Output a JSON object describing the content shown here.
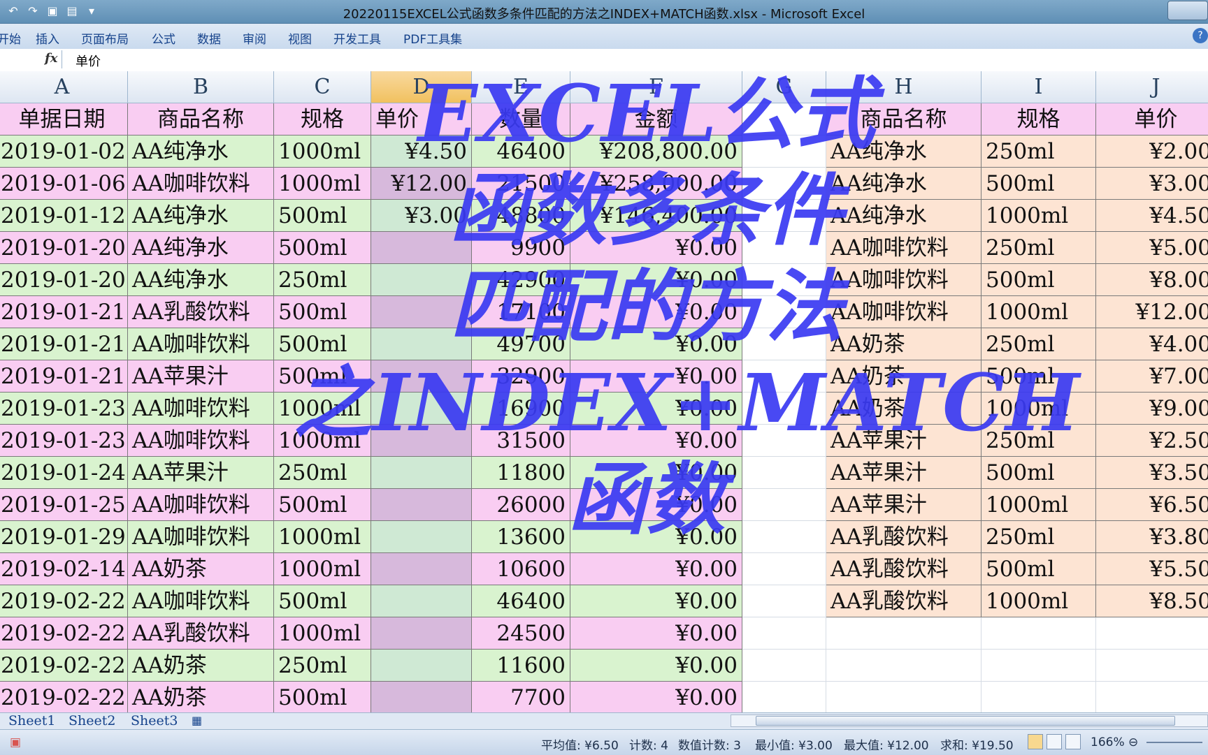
{
  "window": {
    "title": "20220115EXCEL公式函数多条件匹配的方法之INDEX+MATCH函数.xlsx - Microsoft Excel"
  },
  "ribbon": {
    "tabs": [
      "开始",
      "插入",
      "页面布局",
      "公式",
      "数据",
      "审阅",
      "视图",
      "开发工具",
      "PDF工具集"
    ]
  },
  "formula_bar": {
    "fx_label": "fx",
    "content": "单价"
  },
  "columns": [
    "A",
    "B",
    "C",
    "D",
    "E",
    "F",
    "G",
    "H",
    "I",
    "J"
  ],
  "selected_column": "D",
  "left_table": {
    "headers": [
      "单据日期",
      "商品名称",
      "规格",
      "单价",
      "数量",
      "金额"
    ],
    "rows": [
      [
        "2019-01-02",
        "AA纯净水",
        "1000ml",
        "¥4.50",
        "46400",
        "¥208,800.00"
      ],
      [
        "2019-01-06",
        "AA咖啡饮料",
        "1000ml",
        "¥12.00",
        "21500",
        "¥258,000.00"
      ],
      [
        "2019-01-12",
        "AA纯净水",
        "500ml",
        "¥3.00",
        "48800",
        "¥146,400.00"
      ],
      [
        "2019-01-20",
        "AA纯净水",
        "500ml",
        "",
        "9900",
        "¥0.00"
      ],
      [
        "2019-01-20",
        "AA纯净水",
        "250ml",
        "",
        "42900",
        "¥0.00"
      ],
      [
        "2019-01-21",
        "AA乳酸饮料",
        "500ml",
        "",
        "17100",
        "¥0.00"
      ],
      [
        "2019-01-21",
        "AA咖啡饮料",
        "500ml",
        "",
        "49700",
        "¥0.00"
      ],
      [
        "2019-01-21",
        "AA苹果汁",
        "500ml",
        "",
        "32900",
        "¥0.00"
      ],
      [
        "2019-01-23",
        "AA咖啡饮料",
        "1000ml",
        "",
        "16900",
        "¥0.00"
      ],
      [
        "2019-01-23",
        "AA咖啡饮料",
        "1000ml",
        "",
        "31500",
        "¥0.00"
      ],
      [
        "2019-01-24",
        "AA苹果汁",
        "250ml",
        "",
        "11800",
        "¥0.00"
      ],
      [
        "2019-01-25",
        "AA咖啡饮料",
        "500ml",
        "",
        "26000",
        "¥0.00"
      ],
      [
        "2019-01-29",
        "AA咖啡饮料",
        "1000ml",
        "",
        "13600",
        "¥0.00"
      ],
      [
        "2019-02-14",
        "AA奶茶",
        "1000ml",
        "",
        "10600",
        "¥0.00"
      ],
      [
        "2019-02-22",
        "AA咖啡饮料",
        "500ml",
        "",
        "46400",
        "¥0.00"
      ],
      [
        "2019-02-22",
        "AA乳酸饮料",
        "1000ml",
        "",
        "24500",
        "¥0.00"
      ],
      [
        "2019-02-22",
        "AA奶茶",
        "250ml",
        "",
        "11600",
        "¥0.00"
      ],
      [
        "2019-02-22",
        "AA奶茶",
        "500ml",
        "",
        "7700",
        "¥0.00"
      ]
    ]
  },
  "right_table": {
    "headers": [
      "商品名称",
      "规格",
      "单价"
    ],
    "rows": [
      [
        "AA纯净水",
        "250ml",
        "¥2.00"
      ],
      [
        "AA纯净水",
        "500ml",
        "¥3.00"
      ],
      [
        "AA纯净水",
        "1000ml",
        "¥4.50"
      ],
      [
        "AA咖啡饮料",
        "250ml",
        "¥5.00"
      ],
      [
        "AA咖啡饮料",
        "500ml",
        "¥8.00"
      ],
      [
        "AA咖啡饮料",
        "1000ml",
        "¥12.00"
      ],
      [
        "AA奶茶",
        "250ml",
        "¥4.00"
      ],
      [
        "AA奶茶",
        "500ml",
        "¥7.00"
      ],
      [
        "AA奶茶",
        "1000ml",
        "¥9.00"
      ],
      [
        "AA苹果汁",
        "250ml",
        "¥2.50"
      ],
      [
        "AA苹果汁",
        "500ml",
        "¥3.50"
      ],
      [
        "AA苹果汁",
        "1000ml",
        "¥6.50"
      ],
      [
        "AA乳酸饮料",
        "250ml",
        "¥3.80"
      ],
      [
        "AA乳酸饮料",
        "500ml",
        "¥5.50"
      ],
      [
        "AA乳酸饮料",
        "1000ml",
        "¥8.50"
      ]
    ]
  },
  "overlay": {
    "lines": [
      "EXCEL公式",
      "函数多条件",
      "匹配的方法",
      "之INDEX+MATCH",
      "函数"
    ],
    "color": "#3a3af2"
  },
  "sheets": [
    "Sheet1",
    "Sheet2",
    "Sheet3"
  ],
  "status_bar": {
    "average": "平均值: ¥6.50",
    "count": "计数: 4",
    "numeric_count": "数值计数: 3",
    "min": "最小值: ¥3.00",
    "max": "最大值: ¥12.00",
    "sum": "求和: ¥19.50",
    "zoom": "166%"
  },
  "colors": {
    "green_row": "#d9f3cf",
    "pink_row": "#f9cdf2",
    "lookup_table": "#fde4d3",
    "title_bar": "#6f9bbf"
  }
}
